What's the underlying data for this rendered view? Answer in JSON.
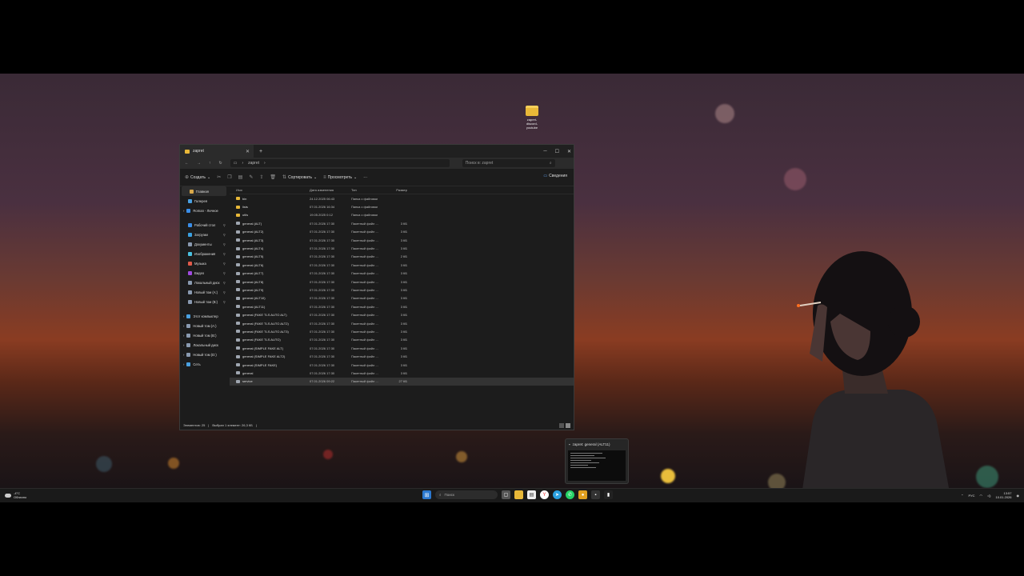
{
  "desktop": {
    "icon_label": "zapret-discord-youtube"
  },
  "explorer": {
    "tab_title": "zapret",
    "newtab": "+",
    "controls": {
      "minimize": "─",
      "maximize": "☐",
      "close": "✕"
    },
    "path": "zapret",
    "search_placeholder": "Поиск в: zapret",
    "toolbar": {
      "create": "Создать",
      "sort": "Сортировать",
      "view": "Просмотреть",
      "more": "···",
      "details": "Сведения"
    },
    "nav": [
      {
        "label": "Главная",
        "color": "#d8a84a",
        "active": true
      },
      {
        "label": "Галерея",
        "color": "#4aa0e0"
      },
      {
        "label": "Roman - Личное",
        "color": "#3a8ee8",
        "chevron": true
      },
      {
        "label": "Рабочий стол",
        "color": "#3a8ee8",
        "pin": true,
        "gap": true
      },
      {
        "label": "Загрузки",
        "color": "#3aa0e0",
        "pin": true
      },
      {
        "label": "Документы",
        "color": "#8a9ab0",
        "pin": true
      },
      {
        "label": "Изображения",
        "color": "#4ac0e0",
        "pin": true
      },
      {
        "label": "Музыка",
        "color": "#e05a4a",
        "pin": true
      },
      {
        "label": "Видео",
        "color": "#a04ae0",
        "pin": true
      },
      {
        "label": "Локальный диск",
        "color": "#8a9ab0",
        "pin": true
      },
      {
        "label": "Новый том (A:)",
        "color": "#8a9ab0",
        "pin": true
      },
      {
        "label": "Новый том (B:)",
        "color": "#8a9ab0",
        "pin": true
      },
      {
        "label": "Этот компьютер",
        "color": "#4aa0e0",
        "chevron": true,
        "gap": true
      },
      {
        "label": "Новый том (A:)",
        "color": "#8a9ab0",
        "chevron": true
      },
      {
        "label": "Новый том (B:)",
        "color": "#8a9ab0",
        "chevron": true
      },
      {
        "label": "Локальный диск",
        "color": "#8a9ab0",
        "chevron": true
      },
      {
        "label": "Новый том (D:)",
        "color": "#8a9ab0",
        "chevron": true
      },
      {
        "label": "Сеть",
        "color": "#4aa0e0",
        "chevron": true
      }
    ],
    "columns": [
      "Имя",
      "Дата изменения",
      "Тип",
      "Размер"
    ],
    "files": [
      {
        "name": "bin",
        "date": "24.12.2025 06:43",
        "type": "Папка с файлами",
        "size": "",
        "kind": "folder"
      },
      {
        "name": "lists",
        "date": "07.01.2026 16:34",
        "type": "Папка с файлами",
        "size": "",
        "kind": "folder"
      },
      {
        "name": "utils",
        "date": "19.05.2025 0:12",
        "type": "Папка с файлами",
        "size": "",
        "kind": "folder"
      },
      {
        "name": "general (ALT)",
        "date": "07.01.2026 17:30",
        "type": "Пакетный файл ...",
        "size": "3 КБ",
        "kind": "bat"
      },
      {
        "name": "general (ALT2)",
        "date": "07.01.2026 17:30",
        "type": "Пакетный файл ...",
        "size": "3 КБ",
        "kind": "bat"
      },
      {
        "name": "general (ALT3)",
        "date": "07.01.2026 17:30",
        "type": "Пакетный файл ...",
        "size": "3 КБ",
        "kind": "bat"
      },
      {
        "name": "general (ALT4)",
        "date": "07.01.2026 17:30",
        "type": "Пакетный файл ...",
        "size": "3 КБ",
        "kind": "bat"
      },
      {
        "name": "general (ALT5)",
        "date": "07.01.2026 17:30",
        "type": "Пакетный файл ...",
        "size": "2 КБ",
        "kind": "bat"
      },
      {
        "name": "general (ALT6)",
        "date": "07.01.2026 17:30",
        "type": "Пакетный файл ...",
        "size": "3 КБ",
        "kind": "bat"
      },
      {
        "name": "general (ALT7)",
        "date": "07.01.2026 17:30",
        "type": "Пакетный файл ...",
        "size": "3 КБ",
        "kind": "bat"
      },
      {
        "name": "general (ALT8)",
        "date": "07.01.2026 17:30",
        "type": "Пакетный файл ...",
        "size": "3 КБ",
        "kind": "bat"
      },
      {
        "name": "general (ALT9)",
        "date": "07.01.2026 17:30",
        "type": "Пакетный файл ...",
        "size": "3 КБ",
        "kind": "bat"
      },
      {
        "name": "general (ALT10)",
        "date": "07.01.2026 17:30",
        "type": "Пакетный файл ...",
        "size": "3 КБ",
        "kind": "bat"
      },
      {
        "name": "general (ALT11)",
        "date": "07.01.2026 17:30",
        "type": "Пакетный файл ...",
        "size": "3 КБ",
        "kind": "bat"
      },
      {
        "name": "general (FAKE TLS AUTO ALT)",
        "date": "07.01.2026 17:30",
        "type": "Пакетный файл ...",
        "size": "3 КБ",
        "kind": "bat"
      },
      {
        "name": "general (FAKE TLS AUTO ALT2)",
        "date": "07.01.2026 17:30",
        "type": "Пакетный файл ...",
        "size": "3 КБ",
        "kind": "bat"
      },
      {
        "name": "general (FAKE TLS AUTO ALT3)",
        "date": "07.01.2026 17:30",
        "type": "Пакетный файл ...",
        "size": "3 КБ",
        "kind": "bat"
      },
      {
        "name": "general (FAKE TLS AUTO)",
        "date": "07.01.2026 17:30",
        "type": "Пакетный файл ...",
        "size": "3 КБ",
        "kind": "bat"
      },
      {
        "name": "general (SIMPLE FAKE ALT)",
        "date": "07.01.2026 17:30",
        "type": "Пакетный файл ...",
        "size": "3 КБ",
        "kind": "bat"
      },
      {
        "name": "general (SIMPLE FAKE ALT2)",
        "date": "07.01.2026 17:30",
        "type": "Пакетный файл ...",
        "size": "3 КБ",
        "kind": "bat"
      },
      {
        "name": "general (SIMPLE FAKE)",
        "date": "07.01.2026 17:30",
        "type": "Пакетный файл ...",
        "size": "3 КБ",
        "kind": "bat"
      },
      {
        "name": "general",
        "date": "07.01.2026 17:30",
        "type": "Пакетный файл ...",
        "size": "3 КБ",
        "kind": "bat"
      },
      {
        "name": "service",
        "date": "07.01.2026 09:22",
        "type": "Пакетный файл ...",
        "size": "27 КБ",
        "kind": "bat",
        "selected": true
      }
    ],
    "status": {
      "count": "Элементов: 25",
      "selected": "Выбран 1 элемент: 26,3 КБ"
    }
  },
  "thumbnail": {
    "title": "zapret: general (ALT11)"
  },
  "taskbar": {
    "temp": "-4°C",
    "weather": "Облачно",
    "search": "Поиск",
    "lang": "РУС",
    "time": "13:57",
    "date": "10.01.2026"
  }
}
